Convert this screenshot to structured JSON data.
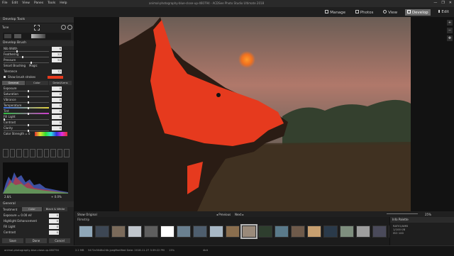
{
  "menubar": {
    "items": [
      "File",
      "Edit",
      "View",
      "Panes",
      "Tools",
      "Help"
    ],
    "title": "animal-photography-blue-close-up-460794 - ACDSee Photo Studio Ultimate 2018",
    "controls": [
      "—",
      "❐",
      "✕"
    ]
  },
  "modes": [
    {
      "label": "Manage",
      "icon": "manage-icon"
    },
    {
      "label": "Photos",
      "icon": "photos-icon"
    },
    {
      "label": "View",
      "icon": "view-icon"
    },
    {
      "label": "Develop",
      "icon": "develop-icon",
      "active": true
    },
    {
      "label": "Edit",
      "icon": "edit-icon"
    }
  ],
  "left_panel": {
    "title": "Develop Tools",
    "tune_label": "Tune",
    "brush": {
      "title": "Develop Brush",
      "rows": [
        {
          "label": "Nib Width",
          "value": "6"
        },
        {
          "label": "Feathering",
          "value": "22"
        },
        {
          "label": "Pressure",
          "value": "50"
        }
      ],
      "smart_brushing": "Smart Brushing",
      "smart_value": "Magic",
      "tolerance_label": "Tolerance",
      "tolerance_value": "72",
      "show_strokes": "Show brush strokes"
    },
    "subtabs": [
      "General",
      "Color",
      "Detail/Lens"
    ],
    "general_rows": [
      {
        "label": "Exposure",
        "value": "0"
      },
      {
        "label": "Saturation",
        "value": "0"
      },
      {
        "label": "Vibrance",
        "value": "0"
      },
      {
        "label": "Temperature",
        "value": "0"
      },
      {
        "label": "Tint",
        "value": "0"
      },
      {
        "label": "Fill Light",
        "value": "0"
      },
      {
        "label": "Contrast",
        "value": "0"
      },
      {
        "label": "Clarity",
        "value": "0"
      }
    ],
    "color_strength": "Color Strength = 0",
    "hist_left": "2.8/L",
    "hist_right": "+ 0.0%",
    "general2": {
      "title": "General",
      "treatment_label": "Treatment",
      "treatment_options": [
        "Color",
        "Black & White"
      ],
      "rows": [
        {
          "label": "Exposure = 0.00 eV",
          "value": "0"
        },
        {
          "label": "Highlight Enhancement",
          "value": "0"
        },
        {
          "label": "Fill Light",
          "value": "0"
        },
        {
          "label": "Contrast",
          "value": "0"
        }
      ]
    },
    "buttons": [
      "Save",
      "Done",
      "Cancel"
    ]
  },
  "filmstrip_toolbar": {
    "show_original": "Show Original",
    "prev": "Previous",
    "next": "Next",
    "zoom": "25%"
  },
  "filmstrip": {
    "title": "Filmstrip",
    "thumb_colors": [
      "#8fa7b8",
      "#3d4754",
      "#7a6a5a",
      "#c0c6cc",
      "#5e5e5e",
      "#ffffff",
      "#6a8090",
      "#4e5e6e",
      "#a8b8c6",
      "#8a6e4e",
      "#9a8a7a",
      "#2e3e2e",
      "#5a7a8a",
      "#6e5a4a",
      "#c8a070",
      "#2a3a4a",
      "#7e8e7e",
      "#9e9e9e",
      "#4a4a5a",
      "#bfbfbf",
      "#1a6ea8",
      "#3e4e4e"
    ],
    "selected_index": 10
  },
  "info_palette": {
    "title": "Info Palette",
    "lines": [
      "RATIO/AMB",
      "1/100 f/8",
      "ISO 100"
    ]
  },
  "statusbar": {
    "file": "animal-photography-blue-close-up-460794",
    "size": "2.2 MB",
    "dims": "5472x3648x24b jpeg",
    "modified": "Modified Date: 2018-11-27 3:39:22 PM",
    "zoom": "13%",
    "mode": "4bit"
  },
  "colors": {
    "accent": "#e63a1e",
    "panel": "#232323",
    "active_mode": "#6c6c6c"
  }
}
